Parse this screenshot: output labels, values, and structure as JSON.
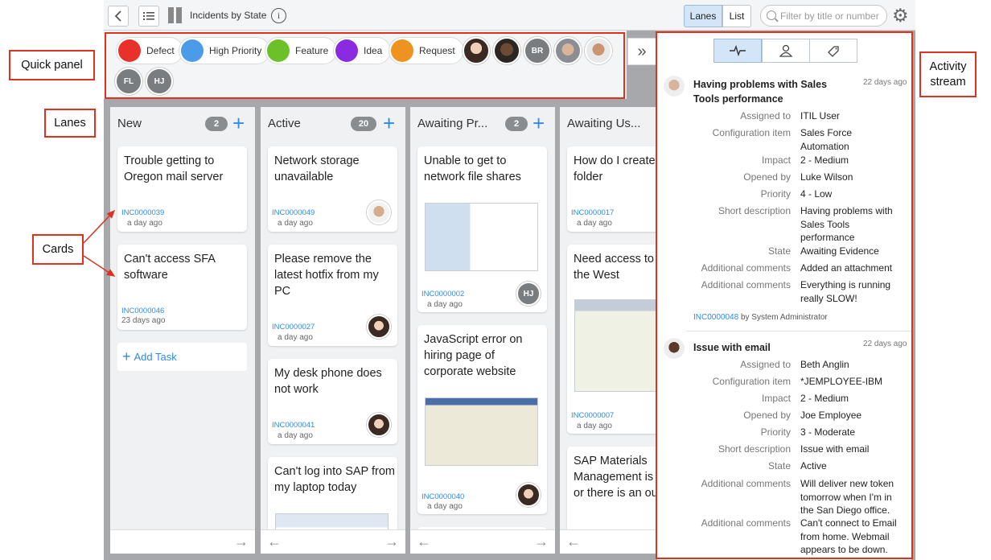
{
  "topbar": {
    "title": "Incidents by State",
    "lanes_label": "Lanes",
    "list_label": "List",
    "search_placeholder": "Filter by title or number",
    "info_glyph": "i",
    "gear_glyph": "⚙"
  },
  "quick_panel": {
    "chips": [
      {
        "label": "Defect",
        "color": "#e8312a"
      },
      {
        "label": "High Priority",
        "color": "#4c9be8"
      },
      {
        "label": "Feature",
        "color": "#6cc12a"
      },
      {
        "label": "Idea",
        "color": "#8a2be2"
      },
      {
        "label": "Request",
        "color": "#ee9220"
      }
    ],
    "initials": [
      "BR",
      "FL",
      "HJ"
    ],
    "expand_glyph": "»"
  },
  "lanes": [
    {
      "name": "New",
      "count": "2",
      "cards": [
        {
          "title": "Trouble getting to Oregon mail server",
          "number": "INC0000039",
          "age": "a day ago"
        },
        {
          "title": "Can't access SFA software",
          "number": "INC0000046",
          "age": "23 days ago"
        }
      ],
      "add_task": "Add Task"
    },
    {
      "name": "Active",
      "count": "20",
      "cards": [
        {
          "title": "Network storage unavailable",
          "number": "INC0000049",
          "age": "a day ago"
        },
        {
          "title": "Please remove the latest hotfix from my PC",
          "number": "INC0000027",
          "age": "a day ago"
        },
        {
          "title": "My desk phone does not work",
          "number": "INC0000041",
          "age": "a day ago"
        },
        {
          "title": "Can't log into SAP from my laptop today"
        }
      ]
    },
    {
      "name": "Awaiting Pr...",
      "count": "2",
      "cards": [
        {
          "title": "Unable to get to network file shares",
          "number": "INC0000002",
          "age": "a day ago",
          "assignee": "HJ"
        },
        {
          "title": "JavaScript error on hiring page of corporate website",
          "number": "INC0000040",
          "age": "a day ago"
        }
      ]
    },
    {
      "name": "Awaiting Us...",
      "cards": [
        {
          "title": "How do I create sub-folder",
          "number": "INC0000017",
          "age": "a day ago"
        },
        {
          "title": "Need access to DB for the West",
          "number": "INC0000007",
          "age": "a day ago"
        },
        {
          "title": "SAP Materials Management is or there is an ou"
        }
      ]
    }
  ],
  "activity": {
    "entries": [
      {
        "title": "Having problems with Sales Tools performance",
        "time": "22 days ago",
        "fields": [
          {
            "k": "Assigned to",
            "v": "ITIL User"
          },
          {
            "k": "Configuration item",
            "v": "Sales Force Automation"
          },
          {
            "k": "Impact",
            "v": "2 - Medium"
          },
          {
            "k": "Opened by",
            "v": "Luke Wilson"
          },
          {
            "k": "Priority",
            "v": "4 - Low"
          },
          {
            "k": "Short description",
            "v": "Having problems with Sales Tools performance"
          },
          {
            "k": "State",
            "v": "Awaiting Evidence"
          },
          {
            "k": "Additional comments",
            "v": "Added an attachment"
          },
          {
            "k": "Additional comments",
            "v": "Everything is running really SLOW!"
          }
        ],
        "number": "INC0000048",
        "by": "by System Administrator"
      },
      {
        "title": "Issue with email",
        "time": "22 days ago",
        "fields": [
          {
            "k": "Assigned to",
            "v": "Beth Anglin"
          },
          {
            "k": "Configuration item",
            "v": "*JEMPLOYEE-IBM"
          },
          {
            "k": "Impact",
            "v": "2 - Medium"
          },
          {
            "k": "Opened by",
            "v": "Joe Employee"
          },
          {
            "k": "Priority",
            "v": "3 - Moderate"
          },
          {
            "k": "Short description",
            "v": "Issue with email"
          },
          {
            "k": "State",
            "v": "Active"
          },
          {
            "k": "Additional comments",
            "v": "Will deliver new token tomorrow when I'm in the San Diego office."
          },
          {
            "k": "Additional comments",
            "v": "Can't connect to Email from home. Webmail appears to be down."
          }
        ]
      }
    ]
  },
  "callouts": {
    "quick_panel": "Quick panel",
    "lanes": "Lanes",
    "cards": "Cards",
    "activity_l1": "Activity",
    "activity_l2": "stream"
  },
  "colors": {
    "accent": "#2f8be6",
    "annotation": "#e0301e"
  }
}
